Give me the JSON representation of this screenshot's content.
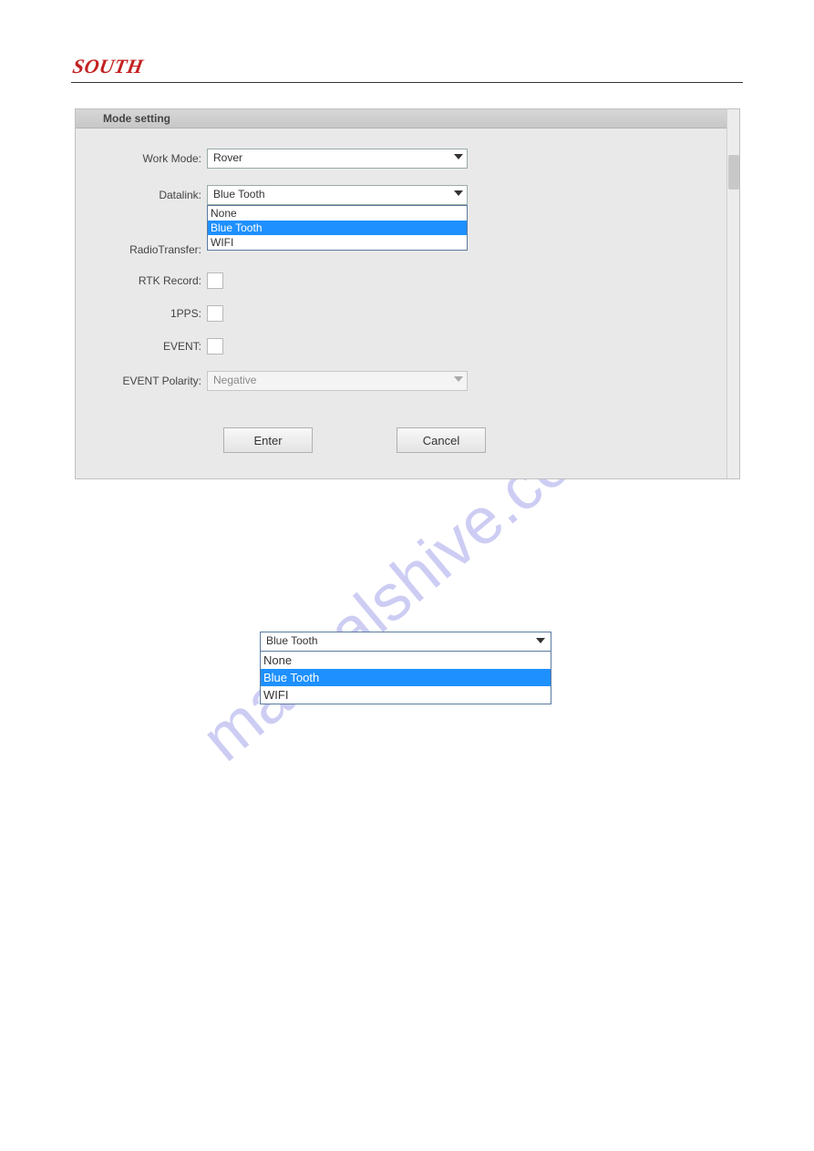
{
  "brand": "SOUTH",
  "watermark": "manualshive.com",
  "panel": {
    "title": "Mode setting",
    "fields": {
      "work_mode_label": "Work Mode:",
      "work_mode_value": "Rover",
      "datalink_label": "Datalink:",
      "datalink_value": "Blue Tooth",
      "datalink_options": {
        "0": "None",
        "1": "Blue Tooth",
        "2": "WIFI"
      },
      "radiotransfer_label": "RadioTransfer:",
      "rtk_record_label": "RTK Record:",
      "pps_label": "1PPS:",
      "event_label": "EVENT:",
      "event_polarity_label": "EVENT Polarity:",
      "event_polarity_value": "Negative"
    },
    "buttons": {
      "enter": "Enter",
      "cancel": "Cancel"
    }
  },
  "lower_select": {
    "value": "Blue Tooth",
    "options": {
      "0": "None",
      "1": "Blue Tooth",
      "2": "WIFI"
    }
  }
}
